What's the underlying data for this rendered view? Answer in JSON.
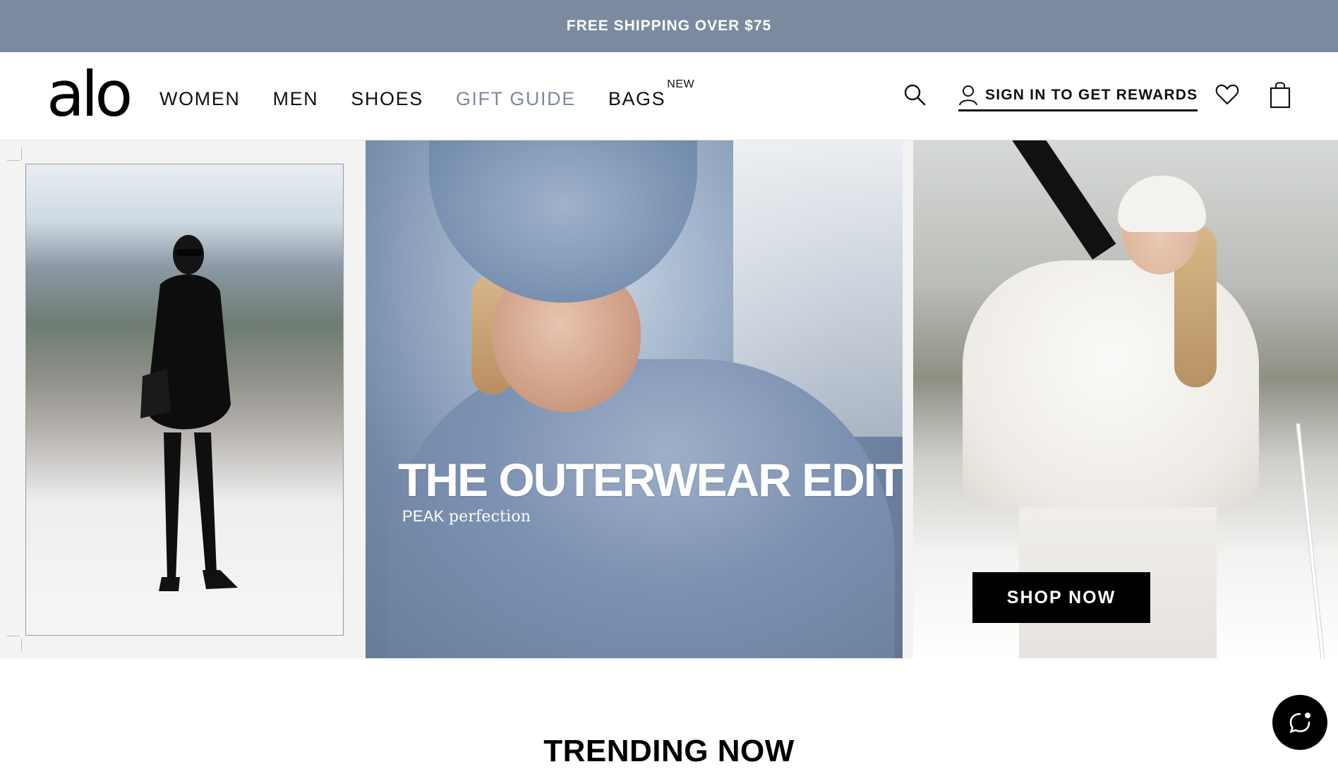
{
  "promo": {
    "text": "FREE SHIPPING OVER $75"
  },
  "brand": {
    "logo_text": "alo"
  },
  "nav": {
    "items": [
      {
        "label": "WOMEN"
      },
      {
        "label": "MEN"
      },
      {
        "label": "SHOES"
      },
      {
        "label": "GIFT GUIDE"
      },
      {
        "label": "BAGS",
        "badge": "NEW"
      }
    ]
  },
  "header_actions": {
    "search_icon": "search-icon",
    "signin_label": "SIGN IN TO GET REWARDS",
    "user_icon": "user-icon",
    "wishlist_icon": "heart-icon",
    "bag_icon": "shopping-bag-icon"
  },
  "hero": {
    "title": "THE OUTERWEAR EDIT",
    "subtitle_brand": "PEAK",
    "subtitle_text": "perfection",
    "cta_label": "SHOP NOW"
  },
  "section": {
    "trending_title": "TRENDING NOW"
  },
  "chat": {
    "icon": "chat-icon"
  },
  "colors": {
    "promo_bg": "#7b8a9e",
    "accent_nav": "#7b8a9e",
    "cta_bg": "#000000",
    "text": "#111111"
  }
}
